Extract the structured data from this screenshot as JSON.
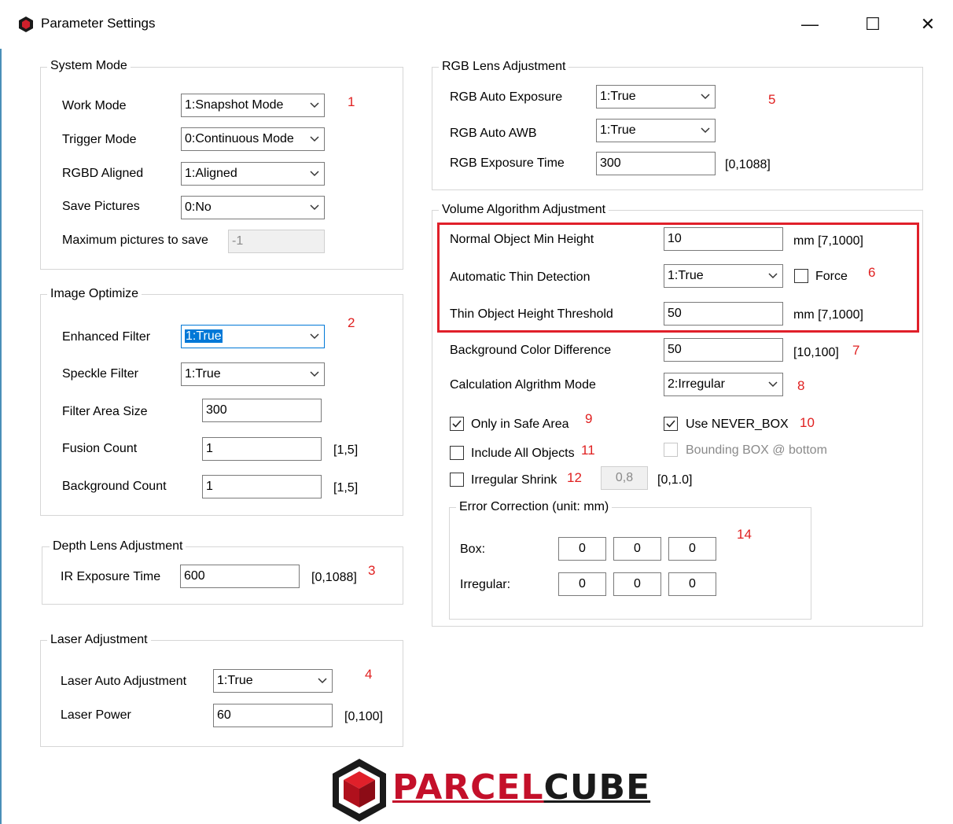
{
  "window": {
    "title": "Parameter Settings",
    "minimize": "—",
    "maximize": "☐",
    "close": "✕"
  },
  "system_mode": {
    "title": "System Mode",
    "work_mode": {
      "label": "Work Mode",
      "value": "1:Snapshot Mode"
    },
    "trigger_mode": {
      "label": "Trigger Mode",
      "value": "0:Continuous Mode"
    },
    "rgbd_aligned": {
      "label": "RGBD Aligned",
      "value": "1:Aligned"
    },
    "save_pictures": {
      "label": "Save Pictures",
      "value": "0:No"
    },
    "max_pictures": {
      "label": "Maximum pictures to save",
      "value": "-1"
    },
    "marker": "1"
  },
  "image_optimize": {
    "title": "Image Optimize",
    "enhanced_filter": {
      "label": "Enhanced Filter",
      "value": "1:True"
    },
    "speckle_filter": {
      "label": "Speckle Filter",
      "value": "1:True"
    },
    "filter_area_size": {
      "label": "Filter Area Size",
      "value": "300"
    },
    "fusion_count": {
      "label": "Fusion Count",
      "value": "1",
      "range": "[1,5]"
    },
    "background_count": {
      "label": "Background Count",
      "value": "1",
      "range": "[1,5]"
    },
    "marker": "2"
  },
  "depth_lens": {
    "title": "Depth Lens Adjustment",
    "ir_exposure": {
      "label": "IR Exposure Time",
      "value": "600",
      "range": "[0,1088]"
    },
    "marker": "3"
  },
  "laser": {
    "title": "Laser Adjustment",
    "auto_adjust": {
      "label": "Laser Auto Adjustment",
      "value": "1:True"
    },
    "power": {
      "label": "Laser Power",
      "value": "60",
      "range": "[0,100]"
    },
    "marker": "4"
  },
  "rgb_lens": {
    "title": "RGB Lens Adjustment",
    "auto_exposure": {
      "label": "RGB Auto Exposure",
      "value": "1:True"
    },
    "auto_awb": {
      "label": "RGB Auto AWB",
      "value": "1:True"
    },
    "exposure_time": {
      "label": "RGB Exposure Time",
      "value": "300",
      "range": "[0,1088]"
    },
    "marker": "5"
  },
  "volume": {
    "title": "Volume Algorithm Adjustment",
    "normal_min_height": {
      "label": "Normal Object Min Height",
      "value": "10",
      "range": "mm [7,1000]"
    },
    "auto_thin": {
      "label": "Automatic Thin Detection",
      "value": "1:True",
      "force_label": "Force"
    },
    "thin_threshold": {
      "label": "Thin Object Height Threshold",
      "value": "50",
      "range": "mm [7,1000]"
    },
    "marker6": "6",
    "bg_color_diff": {
      "label": "Background Color Difference",
      "value": "50",
      "range": "[10,100]"
    },
    "marker7": "7",
    "calc_mode": {
      "label": "Calculation Algrithm Mode",
      "value": "2:Irregular"
    },
    "marker8": "8",
    "only_safe_area": {
      "label": "Only in Safe Area",
      "checked": true
    },
    "marker9": "9",
    "use_never_box": {
      "label": "Use NEVER_BOX",
      "checked": true
    },
    "marker10": "10",
    "include_all": {
      "label": "Include All Objects",
      "checked": false
    },
    "marker11": "11",
    "bounding_bottom": {
      "label": "Bounding BOX @ bottom",
      "checked": false
    },
    "irregular_shrink": {
      "label": "Irregular Shrink",
      "checked": false,
      "value": "0,8",
      "range": "[0,1.0]"
    },
    "marker12": "12",
    "error_correction": {
      "title": "Error Correction (unit: mm)",
      "box_label": "Box:",
      "box_values": [
        "0",
        "0",
        "0"
      ],
      "irregular_label": "Irregular:",
      "irregular_values": [
        "0",
        "0",
        "0"
      ],
      "marker": "14"
    }
  },
  "brand": {
    "logo_text_part1": "PARCEL",
    "logo_text_part2": "CUBE"
  },
  "colors": {
    "accent": "#e0202a",
    "selection": "#0078d7",
    "logo_red": "#c4102a",
    "logo_dark": "#1a1a1a"
  }
}
